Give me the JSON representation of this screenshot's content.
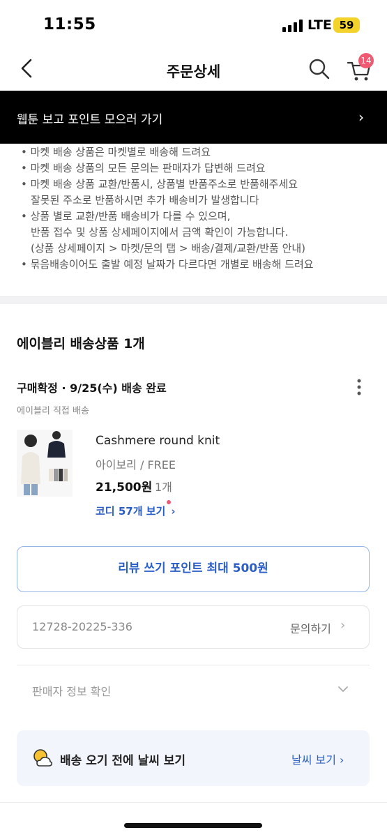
{
  "status_bar": {
    "time": "11:55",
    "network": "LTE",
    "battery": "59"
  },
  "nav": {
    "title": "주문상세",
    "cart_count": "14"
  },
  "banner": {
    "text": "웹툰 보고 포인트 모으러 가기",
    "chevron": "›"
  },
  "notice": {
    "lines": [
      "• 마켓 배송 상품은 마켓별로 배송해 드려요",
      "• 마켓 배송 상품의 모든 문의는 판매자가 답변해 드려요",
      "• 마켓 배송 상품 교환/반품시, 상품별 반품주소로 반품해주세요",
      "잘못된 주소로 반품하시면 추가 배송비가 발생합니다",
      "• 상품 별로 교환/반품 배송비가 다를 수 있으며,",
      "반품 접수 및 상품 상세페이지에서 금액 확인이 가능합니다.",
      "(상품 상세페이지 > 마켓/문의 탭 > 배송/결제/교환/반품 안내)",
      "• 묶음배송이어도 출발 예정 날짜가 다르다면 개별로 배송해 드려요"
    ]
  },
  "shipment": {
    "section_title": "에이블리 배송상품 1개",
    "status": "구매확정 · 9/25(수) 배송 완료",
    "subtitle": "에이블리 직접 배송"
  },
  "product": {
    "name": "Cashmere round knit",
    "option": "아이보리 / FREE",
    "price": "21,500원",
    "quantity": "1개",
    "coordi_link": "코디 57개 보기"
  },
  "review_button": "리뷰 쓰기 포인트 최대 500원",
  "order": {
    "number": "12728-20225-336",
    "inquiry": "문의하기"
  },
  "seller_info": "판매자 정보 확인",
  "weather": {
    "text": "배송 오기 전에 날씨 보기",
    "link": "날씨 보기 ›"
  },
  "colors": {
    "accent_blue": "#2b5fc8",
    "badge_pink": "#ef5a72",
    "battery_yellow": "#f4d22c"
  }
}
